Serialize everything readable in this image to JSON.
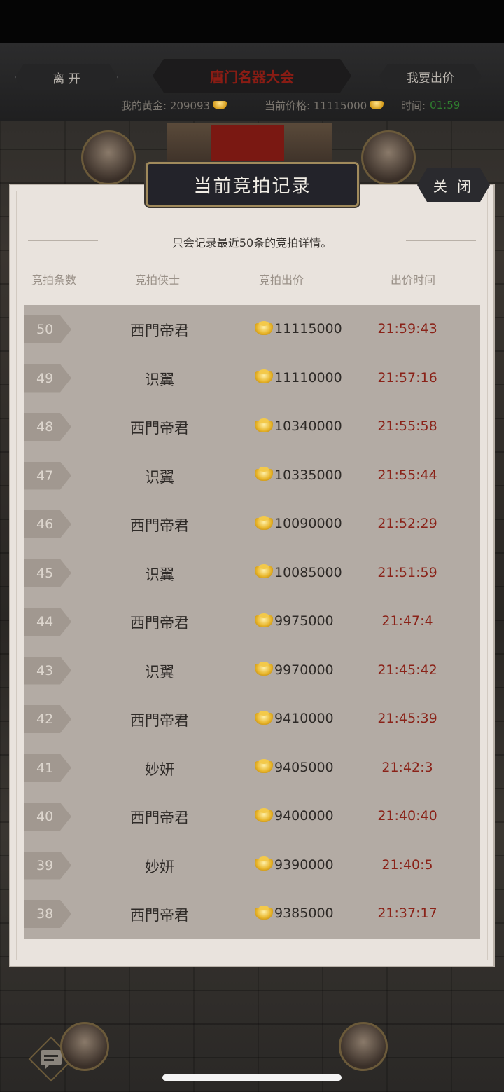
{
  "header": {
    "leave_label": "离 开",
    "title": "唐门名器大会",
    "bid_label": "我要出价",
    "my_gold_label": "我的黄金: 209093",
    "current_price_label": "当前价格: 11115000",
    "time_label": "时间:",
    "time_value": "01:59"
  },
  "dialog": {
    "title": "当前竞拍记录",
    "close_label": "关 闭",
    "notice": "只会记录最近50条的竞拍详情。",
    "columns": [
      "竞拍条数",
      "竞拍侠士",
      "竞拍出价",
      "出价时间"
    ],
    "rows": [
      {
        "num": "50",
        "name": "西門帝君",
        "price": "11115000",
        "time": "21:59:43"
      },
      {
        "num": "49",
        "name": "识翼",
        "price": "11110000",
        "time": "21:57:16"
      },
      {
        "num": "48",
        "name": "西門帝君",
        "price": "10340000",
        "time": "21:55:58"
      },
      {
        "num": "47",
        "name": "识翼",
        "price": "10335000",
        "time": "21:55:44"
      },
      {
        "num": "46",
        "name": "西門帝君",
        "price": "10090000",
        "time": "21:52:29"
      },
      {
        "num": "45",
        "name": "识翼",
        "price": "10085000",
        "time": "21:51:59"
      },
      {
        "num": "44",
        "name": "西門帝君",
        "price": "9975000",
        "time": "21:47:4"
      },
      {
        "num": "43",
        "name": "识翼",
        "price": "9970000",
        "time": "21:45:42"
      },
      {
        "num": "42",
        "name": "西門帝君",
        "price": "9410000",
        "time": "21:45:39"
      },
      {
        "num": "41",
        "name": "妙妍",
        "price": "9405000",
        "time": "21:42:3"
      },
      {
        "num": "40",
        "name": "西門帝君",
        "price": "9400000",
        "time": "21:40:40"
      },
      {
        "num": "39",
        "name": "妙妍",
        "price": "9390000",
        "time": "21:40:5"
      },
      {
        "num": "38",
        "name": "西門帝君",
        "price": "9385000",
        "time": "21:37:17"
      }
    ]
  },
  "icons": {
    "gold": "gold-ingot-icon",
    "chat": "chat-icon"
  },
  "colors": {
    "time_text": "#8a2218",
    "timer_text": "#2f7d2f",
    "title_red": "#8a1c14"
  }
}
